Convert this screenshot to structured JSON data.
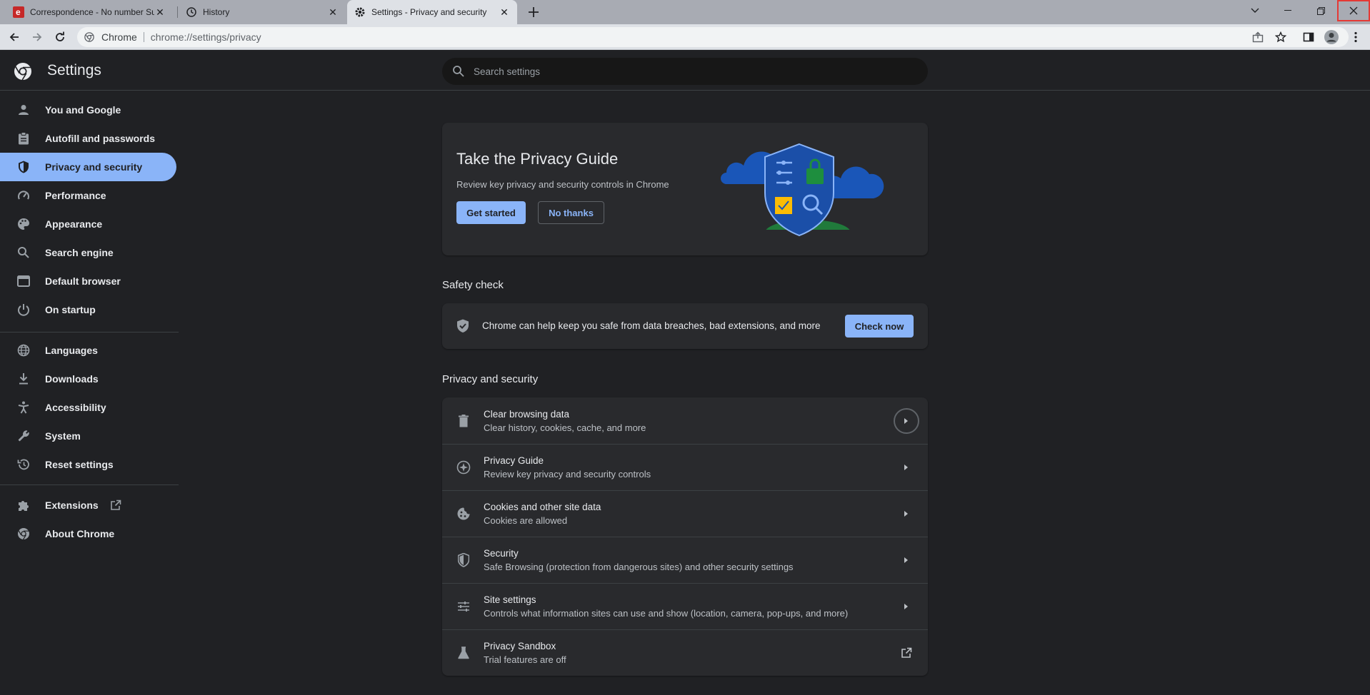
{
  "browser": {
    "tabs": [
      {
        "title": "Correspondence - No number Su",
        "favicon": "e-logo-icon",
        "active": false
      },
      {
        "title": "History",
        "favicon": "history-icon",
        "active": false
      },
      {
        "title": "Settings - Privacy and security",
        "favicon": "gear-icon",
        "active": true
      }
    ],
    "omnibox": {
      "site_label": "Chrome",
      "url": "chrome://settings/privacy"
    }
  },
  "header": {
    "title": "Settings",
    "search_placeholder": "Search settings"
  },
  "sidebar": {
    "items": [
      {
        "label": "You and Google",
        "icon": "person-icon"
      },
      {
        "label": "Autofill and passwords",
        "icon": "clipboard-icon"
      },
      {
        "label": "Privacy and security",
        "icon": "shield-icon",
        "selected": true
      },
      {
        "label": "Performance",
        "icon": "speedometer-icon"
      },
      {
        "label": "Appearance",
        "icon": "palette-icon"
      },
      {
        "label": "Search engine",
        "icon": "search-icon"
      },
      {
        "label": "Default browser",
        "icon": "browser-window-icon"
      },
      {
        "label": "On startup",
        "icon": "power-icon"
      },
      {
        "label": "Languages",
        "icon": "globe-icon"
      },
      {
        "label": "Downloads",
        "icon": "download-icon"
      },
      {
        "label": "Accessibility",
        "icon": "accessibility-icon"
      },
      {
        "label": "System",
        "icon": "wrench-icon"
      },
      {
        "label": "Reset settings",
        "icon": "reset-icon"
      },
      {
        "label": "Extensions",
        "icon": "puzzle-icon"
      },
      {
        "label": "About Chrome",
        "icon": "chrome-icon"
      }
    ]
  },
  "privacy_guide": {
    "title": "Take the Privacy Guide",
    "subtitle": "Review key privacy and security controls in Chrome",
    "get_started": "Get started",
    "no_thanks": "No thanks"
  },
  "safety_check": {
    "section_title": "Safety check",
    "text": "Chrome can help keep you safe from data breaches, bad extensions, and more",
    "button": "Check now"
  },
  "privacy_section": {
    "section_title": "Privacy and security",
    "rows": [
      {
        "label": "Clear browsing data",
        "sub": "Clear history, cookies, cache, and more",
        "icon": "trash-icon"
      },
      {
        "label": "Privacy Guide",
        "sub": "Review key privacy and security controls",
        "icon": "compass-icon"
      },
      {
        "label": "Cookies and other site data",
        "sub": "Cookies are allowed",
        "icon": "cookie-icon"
      },
      {
        "label": "Security",
        "sub": "Safe Browsing (protection from dangerous sites) and other security settings",
        "icon": "shield-icon"
      },
      {
        "label": "Site settings",
        "sub": "Controls what information sites can use and show (location, camera, pop-ups, and more)",
        "icon": "sliders-icon"
      },
      {
        "label": "Privacy Sandbox",
        "sub": "Trial features are off",
        "icon": "flask-icon"
      }
    ]
  },
  "colors": {
    "accent": "#8ab4f8",
    "background": "#202124",
    "card": "#292a2d"
  }
}
